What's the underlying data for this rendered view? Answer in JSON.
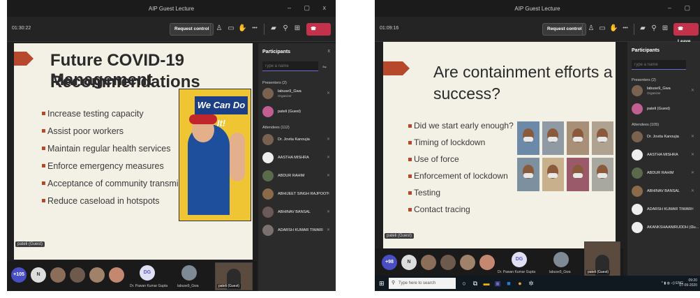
{
  "left": {
    "window_title": "AIP Guest Lecture",
    "timer": "01:30:22",
    "request_control": "Request control",
    "toolbar_more": "•••",
    "slide": {
      "title_line1": "Future COVID-19 Management",
      "title_line2": "Recommendations",
      "bullets": [
        "Increase testing capacity",
        "Assist poor workers",
        "Maintain regular health services",
        "Enforce emergency measures",
        "Acceptance of community transmission",
        "Reduce caseload in hotspots"
      ],
      "poster_text": "We Can Do It!"
    },
    "presenter_tag": "pateli (Guest)",
    "roster": {
      "overflow_count": "+105",
      "letter_avatar": "N",
      "dg_avatar": "DG",
      "dg_name": "Dr. Pawan Kumar Gupta",
      "organizer_name": "labuse9_Gwa",
      "cam_name": "pateli (Guest)"
    },
    "panel": {
      "title": "Participants",
      "close": "x",
      "search_placeholder": "Type a name",
      "presenters_label": "Presenters (2)",
      "presenters": [
        {
          "name": "labuse9_Gwa",
          "sub": "Organizer"
        },
        {
          "name": "pateli (Guest)",
          "sub": ""
        }
      ],
      "attendees_label": "Attendees (112)",
      "attendees": [
        {
          "name": "Dr. Jovita Kanoujia"
        },
        {
          "name": "AASTHA MISHRA"
        },
        {
          "name": "ABDUR RAHIM"
        },
        {
          "name": "ABHIJEET SINGH RAJPOOT"
        },
        {
          "name": "ABHINAV BANSAL"
        },
        {
          "name": "ADARSH KUMAR TIWARI"
        }
      ]
    }
  },
  "right": {
    "window_title": "AIP Guest Lecture",
    "timer": "01:09:16",
    "request_control": "Request control",
    "toolbar_more": "•••",
    "leave_label": "Leave",
    "slide": {
      "title_line1": "Are containment efforts a",
      "title_line2": "success?",
      "bullets": [
        "Did we start early enough?",
        "Timing of lockdown",
        "Use of force",
        "Enforcement of lockdown",
        "Testing",
        "Contact tracing"
      ]
    },
    "presenter_tag": "pateli (Guest)",
    "roster": {
      "overflow_count": "+98",
      "letter_avatar": "N",
      "dg_avatar": "DG",
      "dg_name": "Dr. Pawan Kumar Gupta",
      "organizer_name": "labuse9_Gwa",
      "cam_name": "pateli (Guest)"
    },
    "panel": {
      "title": "Participants",
      "search_placeholder": "Type a name",
      "presenters_label": "Presenters (2)",
      "presenters": [
        {
          "name": "labuse9_Gwa",
          "sub": "Organizer"
        },
        {
          "name": "pateli (Guest)",
          "sub": ""
        }
      ],
      "attendees_label": "Attendees (105)",
      "attendees": [
        {
          "name": "Dr. Jovita Kanoujia"
        },
        {
          "name": "AASTHA MISHRA"
        },
        {
          "name": "ABDUR RAHIM"
        },
        {
          "name": "ABHINAV BANSAL"
        },
        {
          "name": "ADARSH KUMAR TIWARI"
        },
        {
          "name": "AKANKSHAANIRUDDH (Gu..."
        }
      ]
    },
    "taskbar": {
      "search_placeholder": "Type here to search",
      "tray_lang": "ENG",
      "time": "09:20",
      "date": "07-09-2020"
    }
  }
}
